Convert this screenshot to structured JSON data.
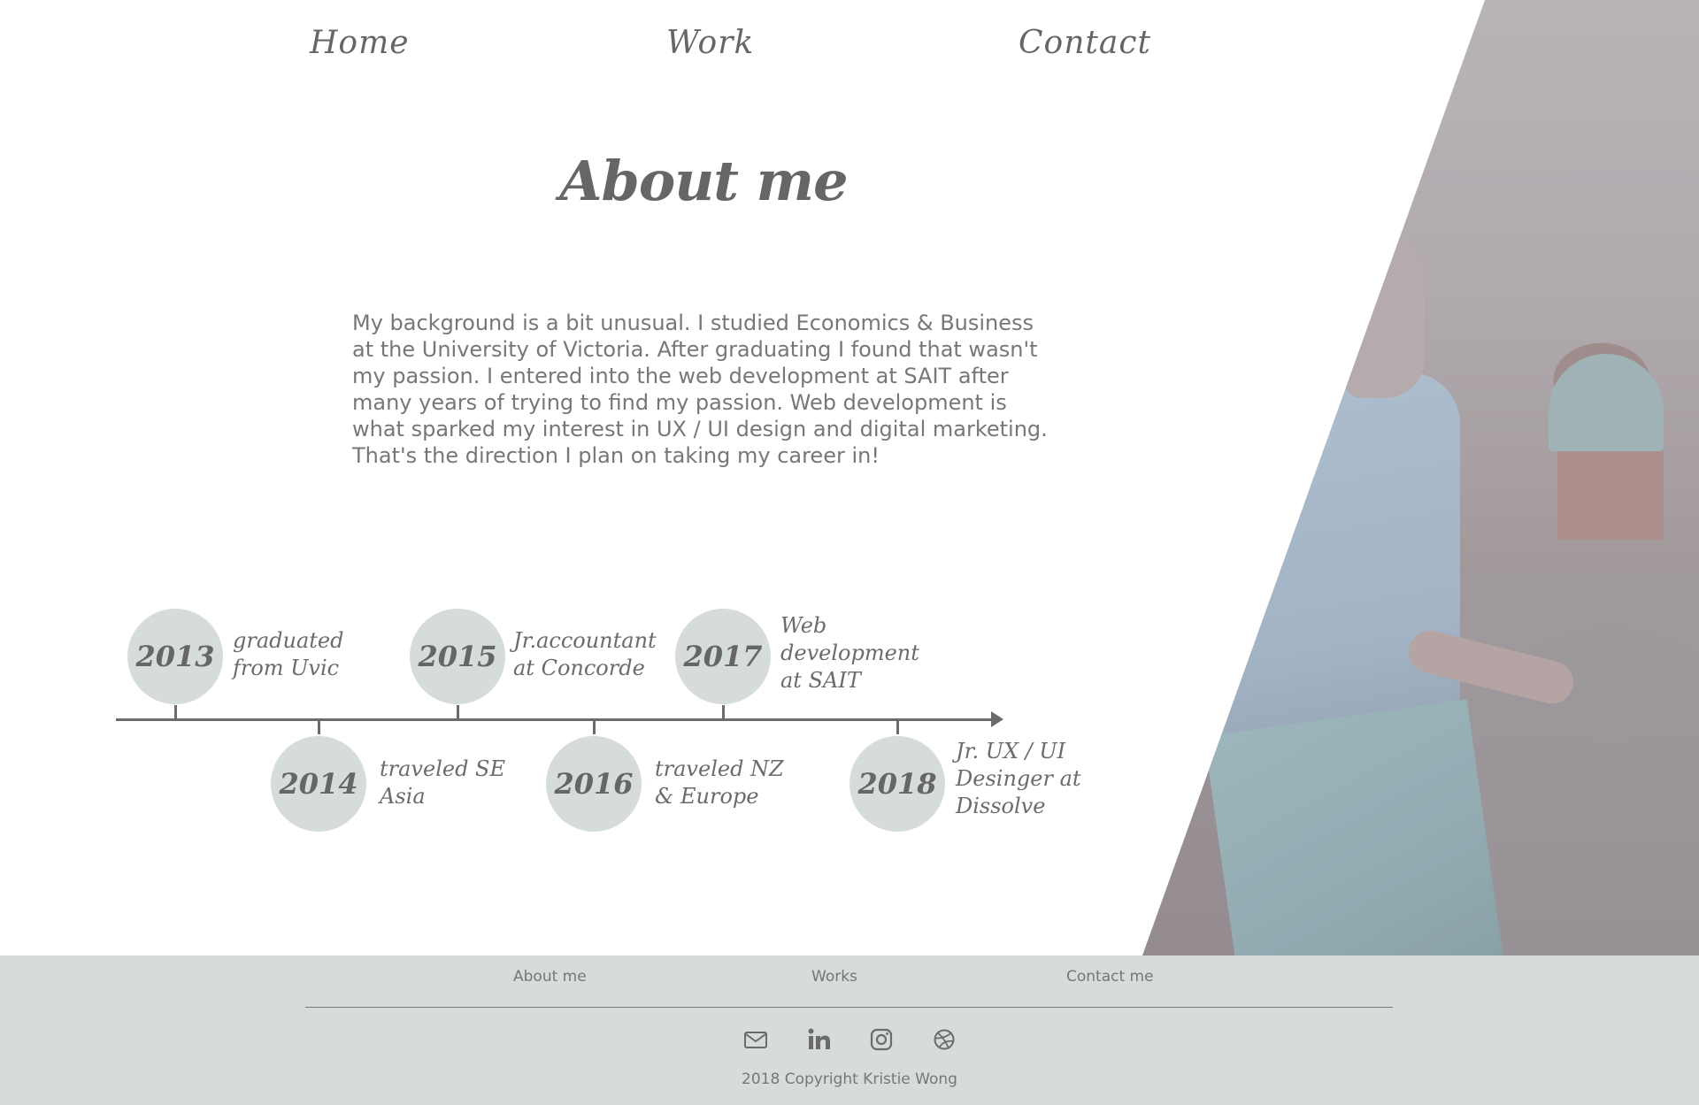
{
  "nav": {
    "home": "Home",
    "work": "Work",
    "contact": "Contact"
  },
  "page": {
    "title": "About me",
    "bio": "My background is a bit unusual. I studied Economics & Business at the University of Victoria. After graduating I found that wasn't my passion. I entered into the web development at SAIT after many years of trying to find my passion. Web development is what sparked my interest in UX / UI design and digital marketing. That's the direction I plan on taking my career in!"
  },
  "timeline": {
    "events": [
      {
        "year": "2013",
        "text": "graduated\nfrom Uvic"
      },
      {
        "year": "2014",
        "text": "traveled SE\nAsia"
      },
      {
        "year": "2015",
        "text": "Jr.accountant\nat Concorde"
      },
      {
        "year": "2016",
        "text": "traveled NZ\n& Europe"
      },
      {
        "year": "2017",
        "text": "Web\ndevelopment\nat SAIT"
      },
      {
        "year": "2018",
        "text": "Jr. UX / UI\nDesinger at\nDissolve"
      }
    ]
  },
  "footer": {
    "links": {
      "about": "About me",
      "works": "Works",
      "contact": "Contact me"
    },
    "icons": [
      "mail-icon",
      "linkedin-icon",
      "instagram-icon",
      "dribbble-icon"
    ],
    "copyright": "2018 Copyright Kristie Wong"
  },
  "colors": {
    "text": "#6b6b6b",
    "circle": "#d6dcd8",
    "footer_bg": "#d6dcd8"
  }
}
